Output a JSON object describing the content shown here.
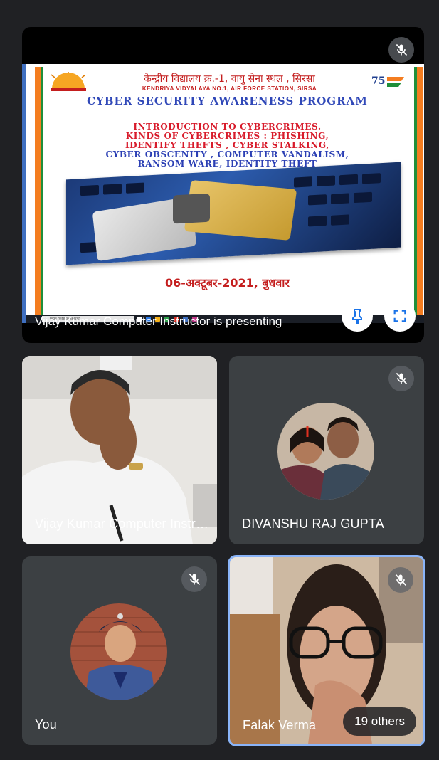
{
  "presentation": {
    "slide": {
      "hindi_header": "केन्द्रीय विद्यालय क्र.-1, वायु सेना स्थल , सिरसा",
      "school_name": "KENDRIYA VIDYALAYA NO.1, AIR FORCE STATION, SIRSA",
      "title": "CYBER SECURITY AWARENESS PROGRAM",
      "line1": "INTRODUCTION TO CYBERCRIMES.",
      "line2": "KINDS OF CYBERCRIMES : PHISHING,",
      "line3": "IDENTIFY THEFTS , CYBER STALKING,",
      "line4": "CYBER OBSCENITY , COMPUTER VANDALISM,",
      "line5": "RANSOM WARE, IDENTITY THEFT",
      "date": "06-अक्टूबर-2021, बुधवार",
      "taskbar_search": "Type here to search"
    },
    "presenter_label": "Vijay Kumar Computer Instructor is presenting",
    "pin_icon": "pin-icon",
    "fullscreen_icon": "fullscreen-icon",
    "mute_icon": "mic-off-icon"
  },
  "participants": [
    {
      "name": "Vijay Kumar Computer Instructor",
      "muted": false
    },
    {
      "name": "DIVANSHU RAJ GUPTA",
      "muted": true
    },
    {
      "name": "You",
      "muted": true
    },
    {
      "name": "Falak Verma",
      "muted": true
    }
  ],
  "others_count_label": "19 others",
  "colors": {
    "background": "#202124",
    "tile": "#3c4043",
    "active_speaker_border": "#8ab4f8"
  }
}
